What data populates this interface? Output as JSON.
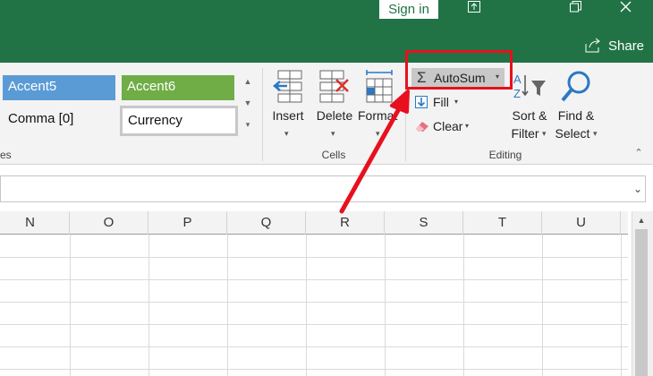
{
  "titlebar": {
    "signin_label": "Sign in",
    "share_label": "Share",
    "ribbon_display_icon": "ribbon-display-options-icon",
    "restore_icon": "restore-icon",
    "close_icon": "close-icon"
  },
  "styles": {
    "accent5": "Accent5",
    "accent6": "Accent6",
    "comma0": "Comma [0]",
    "currency": "Currency",
    "group_label_partial": "es"
  },
  "cells_group": {
    "insert": "Insert",
    "delete": "Delete",
    "format": "Format",
    "label": "Cells"
  },
  "editing_group": {
    "autosum": "AutoSum",
    "fill": "Fill",
    "clear": "Clear",
    "sort_line1": "Sort &",
    "sort_line2": "Filter",
    "find_line1": "Find &",
    "find_line2": "Select",
    "label": "Editing"
  },
  "columns": [
    "N",
    "O",
    "P",
    "Q",
    "R",
    "S",
    "T",
    "U"
  ],
  "colors": {
    "excel_green": "#217346",
    "accent5": "#5b9bd5",
    "accent6": "#70ad47",
    "highlight": "#e8101e"
  }
}
